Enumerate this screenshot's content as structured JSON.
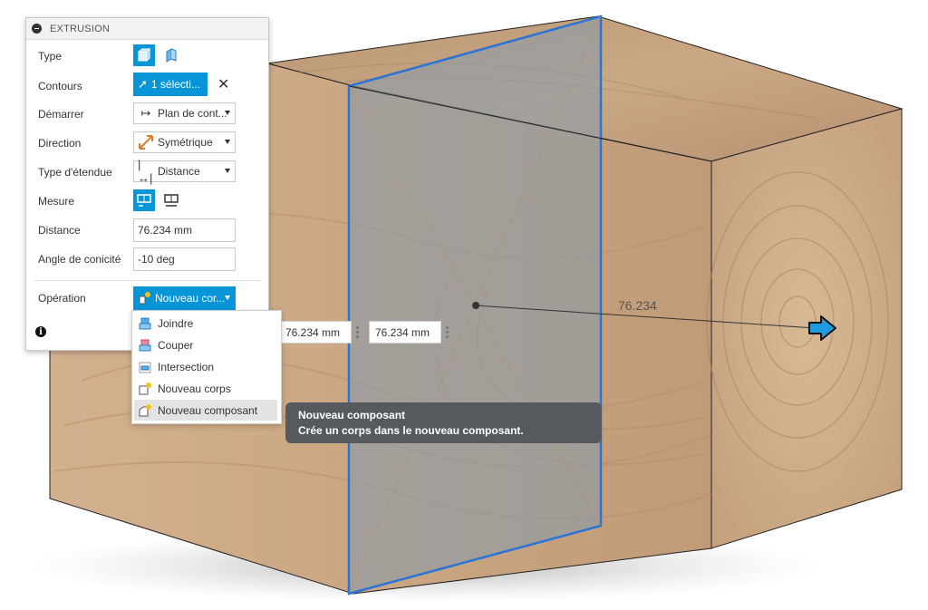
{
  "panel": {
    "title": "EXTRUSION",
    "rows": {
      "type": {
        "label": "Type"
      },
      "contours": {
        "label": "Contours",
        "button": "1 sélecti..."
      },
      "start": {
        "label": "Démarrer",
        "value": "Plan de cont..."
      },
      "direction": {
        "label": "Direction",
        "value": "Symétrique"
      },
      "extent": {
        "label": "Type d'étendue",
        "value": "Distance"
      },
      "measure": {
        "label": "Mesure"
      },
      "distance": {
        "label": "Distance",
        "value": "76.234 mm"
      },
      "taper": {
        "label": "Angle de conicité",
        "value": "-10 deg"
      },
      "operation": {
        "label": "Opération",
        "value": "Nouveau cor..."
      }
    }
  },
  "menu": {
    "items": [
      {
        "label": "Joindre",
        "icon": "join-icon"
      },
      {
        "label": "Couper",
        "icon": "cut-icon"
      },
      {
        "label": "Intersection",
        "icon": "intersect-icon"
      },
      {
        "label": "Nouveau corps",
        "icon": "new-body-icon"
      },
      {
        "label": "Nouveau composant",
        "icon": "new-component-icon",
        "highlighted": true
      }
    ]
  },
  "tooltip": {
    "title": "Nouveau composant",
    "text": "Crée un corps dans le nouveau composant."
  },
  "viewport": {
    "field_1": "76.234 mm",
    "field_2": "76.234 mm",
    "dimension_label": "76.234"
  },
  "colors": {
    "accent": "#0696d7",
    "wood": "#c9a37c",
    "plane": "#8c9ba8",
    "plane_edge": "#2b74d6"
  }
}
